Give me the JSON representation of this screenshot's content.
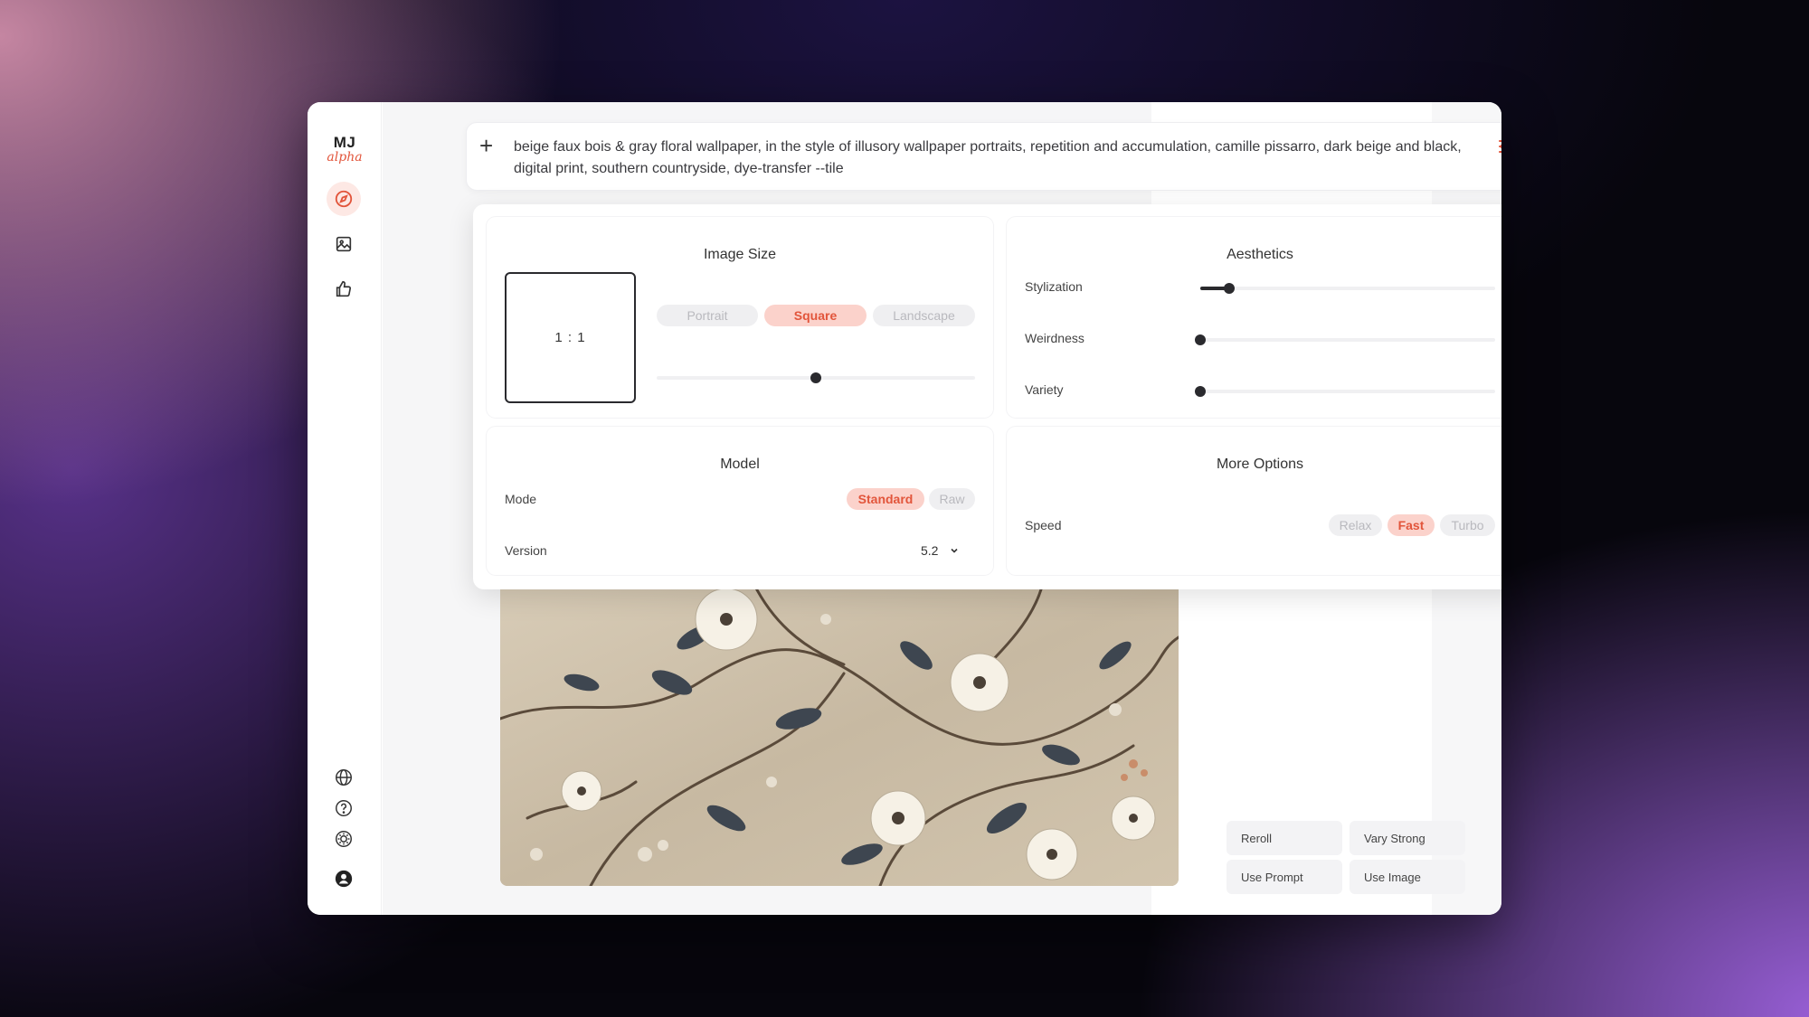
{
  "app": {
    "logo_text": "MJ",
    "logo_sub": "alpha"
  },
  "sidebar": {
    "top_items": [
      {
        "name": "explore",
        "icon": "compass-icon",
        "active": true
      },
      {
        "name": "create",
        "icon": "image-icon",
        "active": false
      },
      {
        "name": "likes",
        "icon": "thumbs-up-icon",
        "active": false
      }
    ],
    "bottom_items": [
      {
        "name": "language",
        "icon": "globe-icon"
      },
      {
        "name": "help",
        "icon": "question-icon"
      },
      {
        "name": "theme",
        "icon": "brightness-icon"
      },
      {
        "name": "account",
        "icon": "user-icon"
      }
    ]
  },
  "prompt": {
    "text": "beige faux bois & gray floral wallpaper, in the style of illusory wallpaper portraits, repetition and accumulation, camille pissarro, dark beige and black, digital print, southern countryside, dye-transfer --tile"
  },
  "image_size": {
    "title": "Image Size",
    "ratio": "1 : 1",
    "options": [
      "Portrait",
      "Square",
      "Landscape"
    ],
    "selected": "Square",
    "slider_value": 0.5
  },
  "aesthetics": {
    "title": "Aesthetics",
    "sliders": [
      {
        "label": "Stylization",
        "value": 0.1
      },
      {
        "label": "Weirdness",
        "value": 0.0
      },
      {
        "label": "Variety",
        "value": 0.0
      }
    ]
  },
  "model": {
    "title": "Model",
    "mode_label": "Mode",
    "mode_options": [
      "Standard",
      "Raw"
    ],
    "mode_selected": "Standard",
    "version_label": "Version",
    "version_value": "5.2"
  },
  "more_options": {
    "title": "More Options",
    "speed_label": "Speed",
    "speed_options": [
      "Relax",
      "Fast",
      "Turbo"
    ],
    "speed_selected": "Fast"
  },
  "actions": {
    "reroll": "Reroll",
    "vary_strong": "Vary Strong",
    "use_prompt": "Use Prompt",
    "use_image": "Use Image"
  },
  "colors": {
    "accent": "#e2553b",
    "accent_bg": "#fbd2cb",
    "dark": "#2a2a2e"
  }
}
